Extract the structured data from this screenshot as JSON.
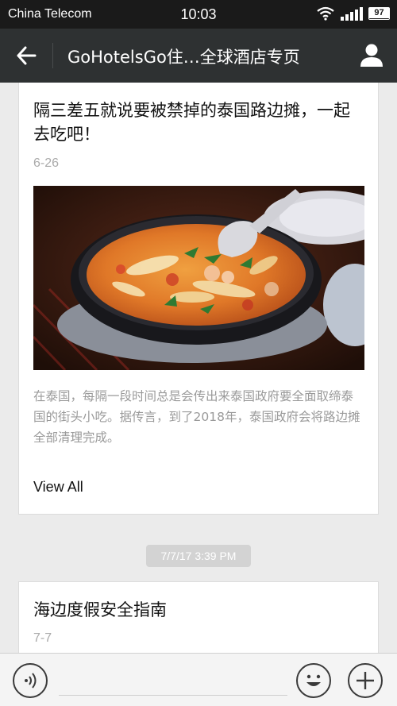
{
  "status_bar": {
    "carrier": "China Telecom",
    "time": "10:03",
    "battery": "97",
    "wifi_icon": "wifi-icon",
    "signal_icon": "signal-icon"
  },
  "nav": {
    "back_icon": "arrow-left-icon",
    "title": "GoHotelsGo住…全球酒店专页",
    "profile_icon": "person-icon"
  },
  "messages": [
    {
      "title": "隔三差五就说要被禁掉的泰国路边摊，一起去吃吧！",
      "date": "6-26",
      "image": "tom-yum-soup-photo",
      "description": "在泰国，每隔一段时间总是会传出来泰国政府要全面取缔泰国的街头小吃。据传言，到了2018年，泰国政府会将路边摊全部清理完成。",
      "view_all": "View All"
    },
    {
      "title": "海边度假安全指南",
      "date": "7-7"
    }
  ],
  "timestamp": "7/7/17 3:39 PM",
  "input_bar": {
    "voice_icon": "voice-icon",
    "emoji_icon": "emoji-icon",
    "add_icon": "plus-icon"
  }
}
